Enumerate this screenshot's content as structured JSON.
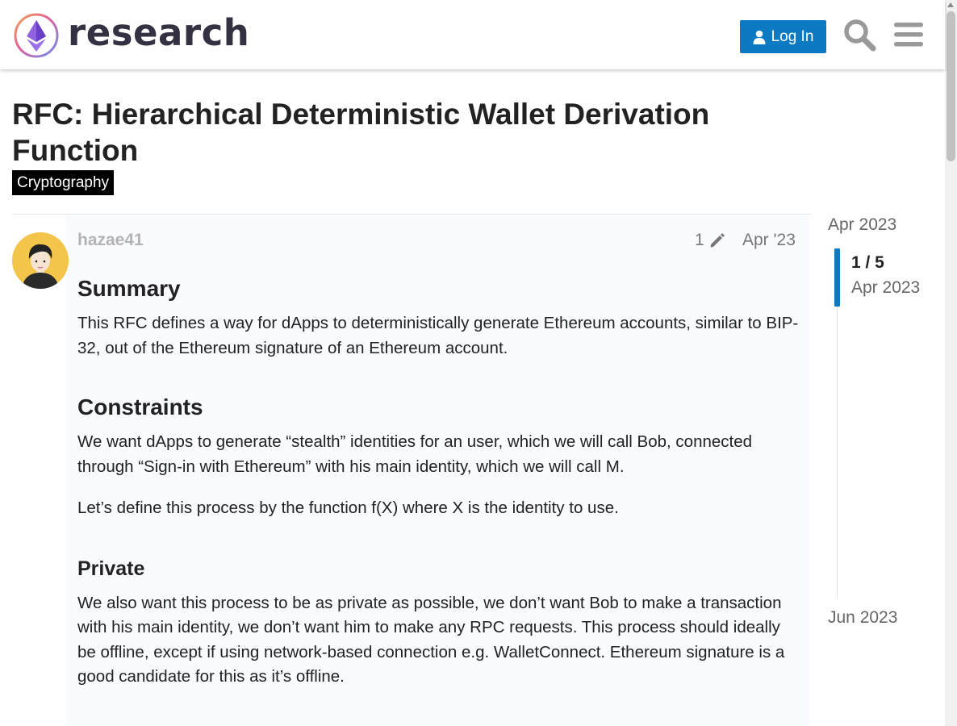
{
  "header": {
    "logo_text": "research",
    "login_label": "Log In",
    "search_icon": "search-icon",
    "menu_icon": "hamburger-menu-icon"
  },
  "topic": {
    "title": "RFC: Hierarchical Deterministic Wallet Derivation Function",
    "category": "Cryptography",
    "category_color": "#000000"
  },
  "post": {
    "author": "hazae41",
    "edit_count": "1",
    "date": "Apr '23",
    "sections": {
      "summary_heading": "Summary",
      "summary_text": "This RFC defines a way for dApps to deterministically generate Ethereum accounts, similar to BIP-32, out of the Ethereum signature of an Ethereum account.",
      "constraints_heading": "Constraints",
      "constraints_text": "We want dApps to generate “stealth” identities for an user, which we will call Bob, connected through “Sign-in with Ethereum” with his main identity, which we will call M.",
      "constraints_text_2": "Let’s define this process by the function f(X) where X is the identity to use.",
      "private_heading": "Private",
      "private_text": "We also want this process to be as private as possible, we don’t want Bob to make a transaction with his main identity, we don’t want him to make any RPC requests. This process should ideally be offline, except if using network-based connection e.g. WalletConnect. Ethereum signature is a good candidate for this as it’s offline."
    }
  },
  "timeline": {
    "start": "Apr 2023",
    "progress": "1 / 5",
    "current_date": "Apr 2023",
    "end": "Jun 2023"
  },
  "colors": {
    "accent": "#0b7ac2",
    "post_background": "#f9fbff"
  }
}
